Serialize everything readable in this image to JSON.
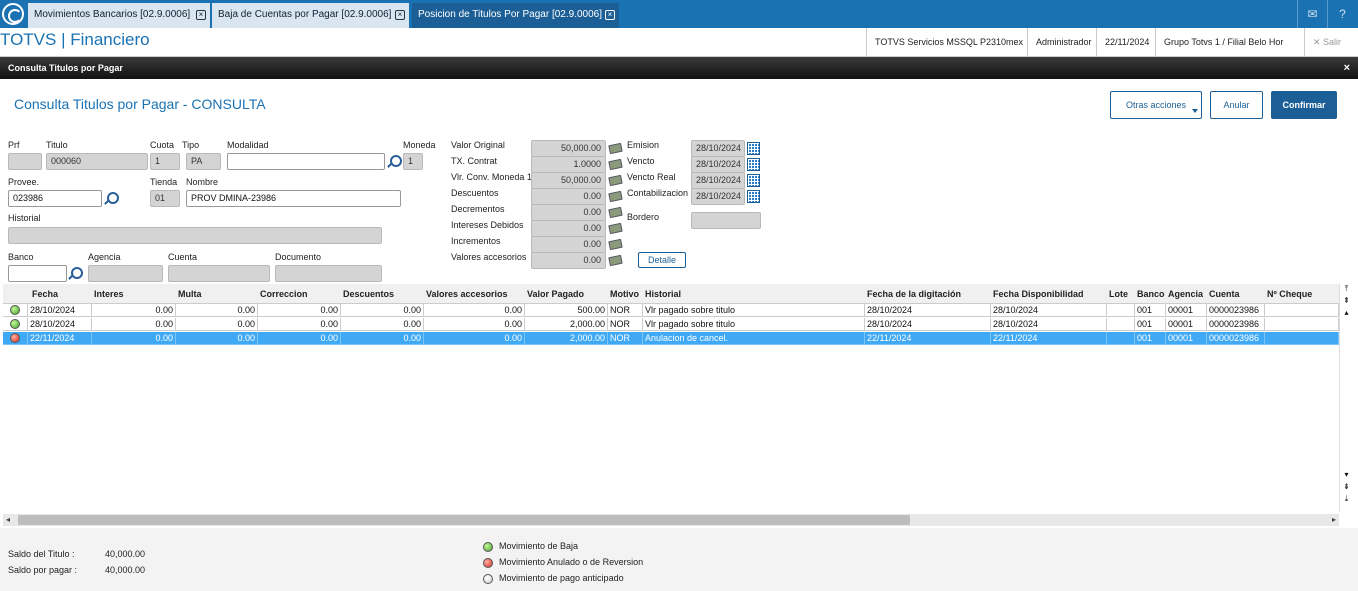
{
  "tabs": [
    {
      "label": "Movimientos Bancarios [02.9.0006]"
    },
    {
      "label": "Baja de Cuentas por Pagar [02.9.0006]"
    },
    {
      "label": "Posicion de Titulos Por Pagar [02.9.0006]"
    }
  ],
  "header": {
    "app_name": "TOTVS | Financiero",
    "environment": "TOTVS Servicios MSSQL P2310mex",
    "user": "Administrador",
    "date": "22/11/2024",
    "company": "Grupo Totvs 1 / Filial Belo Hor",
    "logout": "Salir"
  },
  "dialog": {
    "bar_title": "Consulta Titulos por Pagar",
    "title": "Consulta Titulos por Pagar - CONSULTA",
    "buttons": {
      "other_actions": "Otras acciones",
      "cancel": "Anular",
      "confirm": "Confirmar"
    }
  },
  "form": {
    "prf": {
      "label": "Prf",
      "value": ""
    },
    "titulo": {
      "label": "Titulo",
      "value": "000060"
    },
    "cuota": {
      "label": "Cuota",
      "value": "1"
    },
    "tipo": {
      "label": "Tipo",
      "value": "PA"
    },
    "modalidad": {
      "label": "Modalidad",
      "value": ""
    },
    "moneda": {
      "label": "Moneda",
      "value": "1"
    },
    "provee": {
      "label": "Provee.",
      "value": "023986"
    },
    "tienda": {
      "label": "Tienda",
      "value": "01"
    },
    "nombre": {
      "label": "Nombre",
      "value": "PROV DMINA-23986"
    },
    "historial": {
      "label": "Historial",
      "value": ""
    },
    "banco": {
      "label": "Banco",
      "value": ""
    },
    "agencia": {
      "label": "Agencia",
      "value": ""
    },
    "cuenta": {
      "label": "Cuenta",
      "value": ""
    },
    "documento": {
      "label": "Documento",
      "value": ""
    },
    "values": [
      {
        "label": "Valor Original",
        "value": "50,000.00"
      },
      {
        "label": "TX. Contrat",
        "value": "1.0000"
      },
      {
        "label": "Vlr. Conv. Moneda 1",
        "value": "50,000.00"
      },
      {
        "label": "Descuentos",
        "value": "0.00"
      },
      {
        "label": "Decrementos",
        "value": "0.00"
      },
      {
        "label": "Intereses Debidos",
        "value": "0.00"
      },
      {
        "label": "Incrementos",
        "value": "0.00"
      },
      {
        "label": "Valores accesorios",
        "value": "0.00"
      }
    ],
    "dates": [
      {
        "label": "Emision",
        "value": "28/10/2024"
      },
      {
        "label": "Vencto",
        "value": "28/10/2024"
      },
      {
        "label": "Vencto Real",
        "value": "28/10/2024"
      },
      {
        "label": "Contabilizacion",
        "value": "28/10/2024"
      }
    ],
    "bordero": {
      "label": "Bordero",
      "value": ""
    },
    "detalle_label": "Detalle"
  },
  "grid": {
    "columns": [
      "Fecha",
      "Interes",
      "Multa",
      "Correccion",
      "Descuentos",
      "Valores accesorios",
      "Valor Pagado",
      "Motivo",
      "Historial",
      "Fecha de la digitación",
      "Fecha Disponibilidad",
      "Lote",
      "Banco",
      "Agencia",
      "Cuenta",
      "Nº Cheque"
    ],
    "rows": [
      {
        "status": "green",
        "cells": [
          "28/10/2024",
          "0.00",
          "0.00",
          "0.00",
          "0.00",
          "0.00",
          "500.00",
          "NOR",
          "Vlr pagado sobre titulo",
          "28/10/2024",
          "28/10/2024",
          "",
          "001",
          "00001",
          "0000023986",
          ""
        ]
      },
      {
        "status": "green",
        "cells": [
          "28/10/2024",
          "0.00",
          "0.00",
          "0.00",
          "0.00",
          "0.00",
          "2,000.00",
          "NOR",
          "Vlr pagado sobre titulo",
          "28/10/2024",
          "28/10/2024",
          "",
          "001",
          "00001",
          "0000023986",
          ""
        ]
      },
      {
        "status": "red",
        "cells": [
          "22/11/2024",
          "0.00",
          "0.00",
          "0.00",
          "0.00",
          "0.00",
          "2,000.00",
          "NOR",
          "Anulacion de cancel.",
          "22/11/2024",
          "22/11/2024",
          "",
          "001",
          "00001",
          "0000023986",
          ""
        ]
      }
    ]
  },
  "footer": {
    "saldo_titulo_label": "Saldo del Titulo :",
    "saldo_titulo_value": "40,000.00",
    "saldo_pagar_label": "Saldo por pagar   :",
    "saldo_pagar_value": "40,000.00",
    "legend": [
      {
        "color": "green",
        "label": "Movimiento de Baja"
      },
      {
        "color": "red",
        "label": "Movimiento Anulado o de Reversion"
      },
      {
        "color": "white",
        "label": "Movimiento de pago anticipado"
      }
    ]
  }
}
